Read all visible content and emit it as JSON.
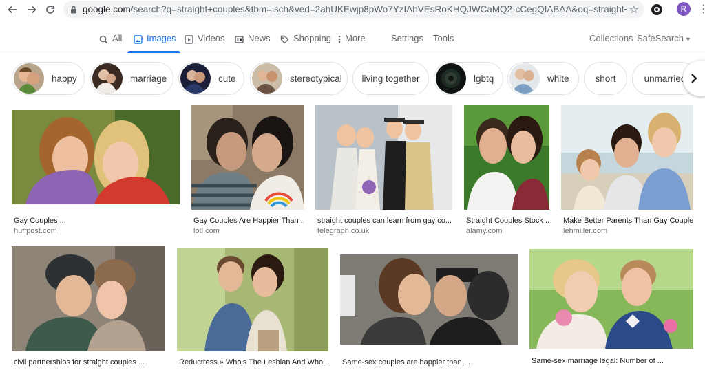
{
  "browser": {
    "url_host": "google.com",
    "url_path": "/search?q=straight+couples&tbm=isch&ved=2ahUKEwjp8pWo7YzIAhVEsRoKHQJWCaMQ2-cCegQIABAA&oq=straight+couples&gs_l...",
    "profile_initial": "R"
  },
  "tabs": [
    {
      "label": "All"
    },
    {
      "label": "Images"
    },
    {
      "label": "Videos"
    },
    {
      "label": "News"
    },
    {
      "label": "Shopping"
    },
    {
      "label": "More"
    }
  ],
  "tools": {
    "settings": "Settings",
    "tools": "Tools"
  },
  "right_links": {
    "collections": "Collections",
    "safesearch": "SafeSearch"
  },
  "chips": [
    {
      "label": "happy"
    },
    {
      "label": "marriage"
    },
    {
      "label": "cute"
    },
    {
      "label": "stereotypical"
    },
    {
      "label": "living together"
    },
    {
      "label": "lgbtq"
    },
    {
      "label": "white"
    },
    {
      "label": "short"
    },
    {
      "label": "unmarried"
    }
  ],
  "results": [
    {
      "caption": "Gay Couples ...",
      "source": "huffpost.com"
    },
    {
      "caption": "Gay Couples Are Happier Than ...",
      "source": "lotl.com"
    },
    {
      "caption": "straight couples can learn from gay co...",
      "source": "telegraph.co.uk"
    },
    {
      "caption": "Straight Couples Stock ...",
      "source": "alamy.com"
    },
    {
      "caption": "Make Better Parents Than Gay Couple...",
      "source": "lehmiller.com"
    },
    {
      "caption": "civil partnerships for straight couples ...",
      "source": ""
    },
    {
      "caption": "Reductress » Who's The Lesbian And Who ...",
      "source": ""
    },
    {
      "caption": "Same-sex couples are happier than ...",
      "source": ""
    },
    {
      "caption": "Same-sex marriage legal: Number of ...",
      "source": ""
    }
  ],
  "icons": {
    "back": "arrow-left-icon",
    "forward": "arrow-right-icon",
    "reload": "reload-icon",
    "lock": "lock-icon",
    "star": "star-icon",
    "search": "search-icon",
    "images": "image-icon",
    "videos": "play-icon",
    "news": "news-icon",
    "shopping": "tag-icon",
    "more": "more-vert-icon",
    "next": "chevron-right-icon"
  },
  "colors": {
    "accent": "#1a73e8",
    "profile": "#7e57c2"
  }
}
